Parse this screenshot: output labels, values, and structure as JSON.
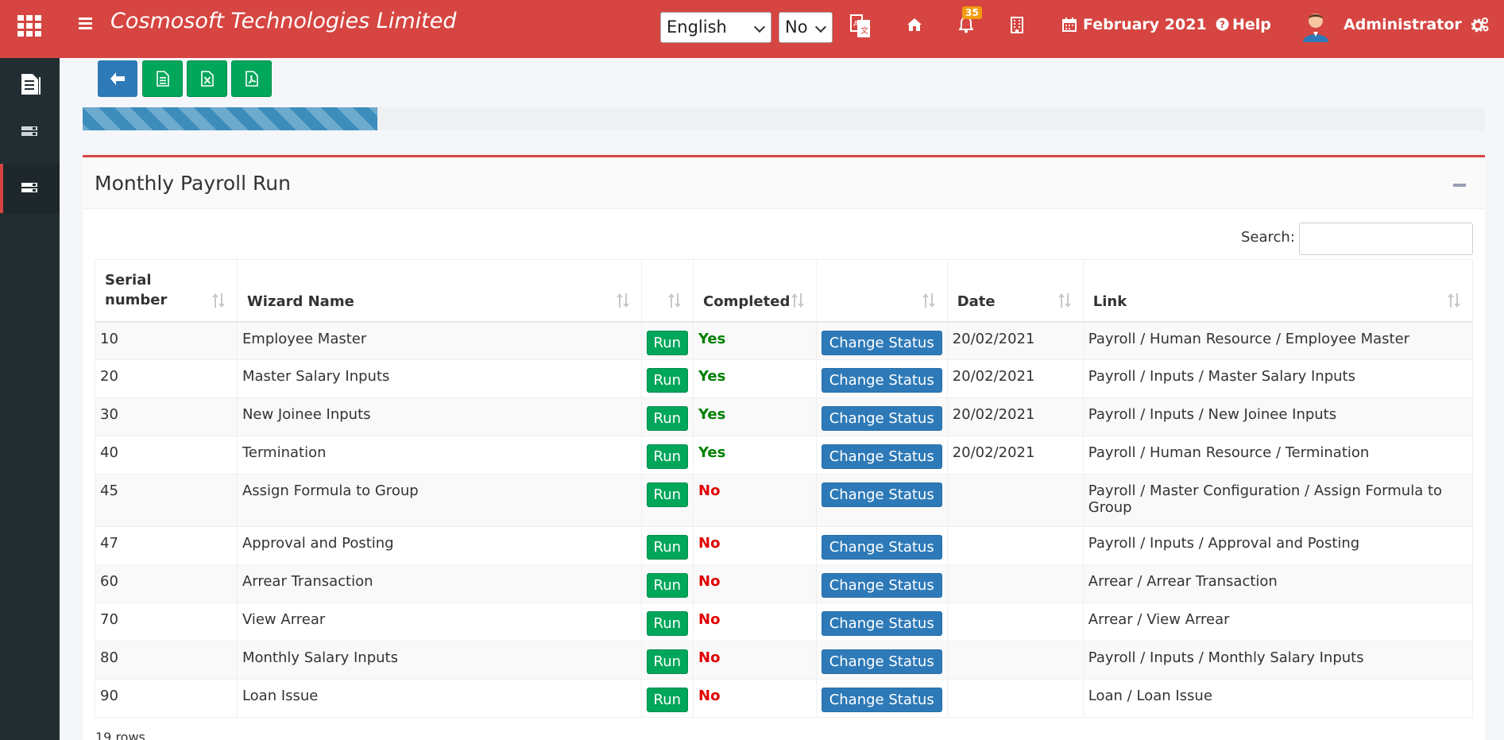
{
  "header": {
    "brand": "Cosmosoft Technologies Limited",
    "language": "English",
    "option": "No",
    "notification_count": "35",
    "period": "February 2021",
    "help": "Help",
    "user": "Administrator"
  },
  "colors": {
    "navbar": "#d64541",
    "sidebar": "#222d32",
    "primary": "#2e7ab8",
    "success": "#00a65a",
    "yes": "#008000",
    "no": "#e00000"
  },
  "sidebar": {
    "items": [
      {
        "icon": "document-icon"
      },
      {
        "icon": "server-icon"
      },
      {
        "icon": "server-icon",
        "active": true
      }
    ]
  },
  "toolbar": {
    "buttons": [
      "back-icon",
      "file-icon",
      "excel-icon",
      "pdf-icon"
    ]
  },
  "progress": {
    "fraction": 0.21
  },
  "box": {
    "title": "Monthly Payroll Run",
    "search_label": "Search:",
    "search_value": "",
    "rows_count": "19 rows"
  },
  "table": {
    "headers": [
      "Serial number",
      "Wizard Name",
      "",
      "Completed",
      "",
      "Date",
      "Link"
    ],
    "run_label": "Run",
    "change_label": "Change Status",
    "rows": [
      {
        "serial": "10",
        "name": "Employee Master",
        "completed": "Yes",
        "date": "20/02/2021",
        "link": "Payroll / Human Resource / Employee Master"
      },
      {
        "serial": "20",
        "name": "Master Salary Inputs",
        "completed": "Yes",
        "date": "20/02/2021",
        "link": "Payroll / Inputs / Master Salary Inputs"
      },
      {
        "serial": "30",
        "name": "New Joinee Inputs",
        "completed": "Yes",
        "date": "20/02/2021",
        "link": "Payroll / Inputs / New Joinee Inputs"
      },
      {
        "serial": "40",
        "name": "Termination",
        "completed": "Yes",
        "date": "20/02/2021",
        "link": "Payroll / Human Resource / Termination"
      },
      {
        "serial": "45",
        "name": "Assign Formula to Group",
        "completed": "No",
        "date": "",
        "link": "Payroll / Master Configuration / Assign Formula to Group"
      },
      {
        "serial": "47",
        "name": "Approval and Posting",
        "completed": "No",
        "date": "",
        "link": "Payroll / Inputs / Approval and Posting"
      },
      {
        "serial": "60",
        "name": "Arrear Transaction",
        "completed": "No",
        "date": "",
        "link": "Arrear / Arrear Transaction"
      },
      {
        "serial": "70",
        "name": "View Arrear",
        "completed": "No",
        "date": "",
        "link": "Arrear / View Arrear"
      },
      {
        "serial": "80",
        "name": "Monthly Salary Inputs",
        "completed": "No",
        "date": "",
        "link": "Payroll / Inputs / Monthly Salary Inputs"
      },
      {
        "serial": "90",
        "name": "Loan Issue",
        "completed": "No",
        "date": "",
        "link": "Loan / Loan Issue"
      }
    ]
  }
}
